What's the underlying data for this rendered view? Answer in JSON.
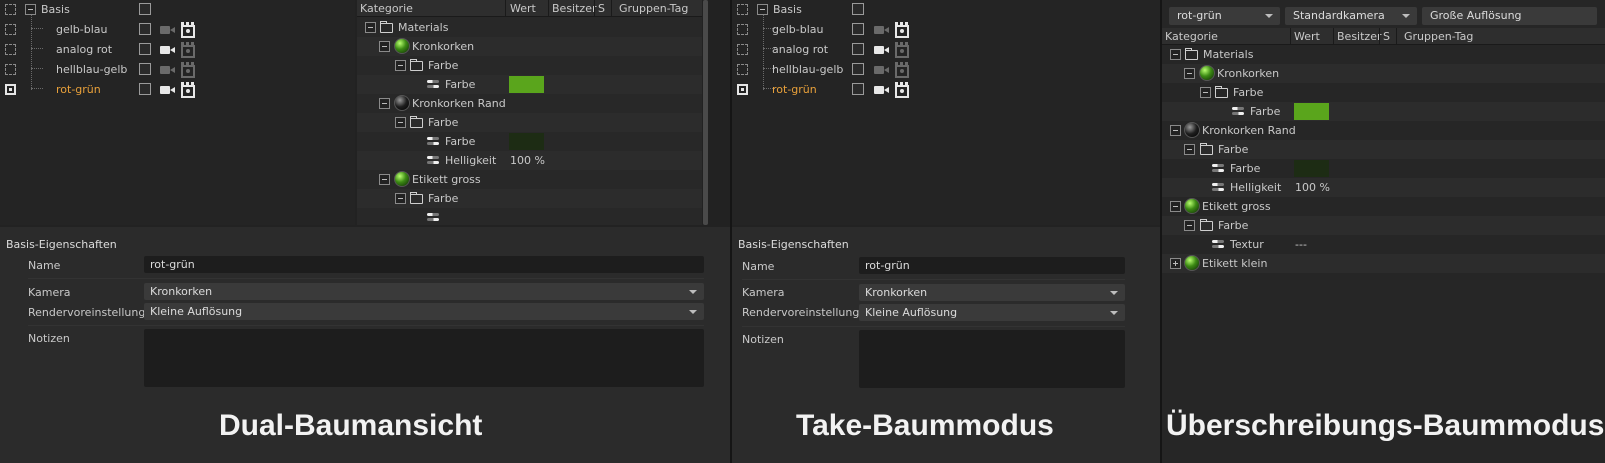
{
  "takes": {
    "root": "Basis",
    "items": [
      {
        "label": "gelb-blau",
        "camera_active": false,
        "render_active": true
      },
      {
        "label": "analog rot",
        "camera_active": true,
        "render_active": false
      },
      {
        "label": "hellblau-gelb",
        "camera_active": false,
        "render_active": false
      },
      {
        "label": "rot-grün",
        "camera_active": true,
        "render_active": true,
        "current": true
      }
    ]
  },
  "override": {
    "headers": {
      "kategorie": "Kategorie",
      "wert": "Wert",
      "besitzer": "Besitzer",
      "s": "S",
      "gruppen_tag": "Gruppen-Tag"
    },
    "rows": {
      "materials": "Materials",
      "kronkorken": "Kronkorken",
      "farbe_group1": "Farbe",
      "farbe_param1": "Farbe",
      "kronkorken_rand": "Kronkorken Rand",
      "farbe_group2": "Farbe",
      "farbe_param2": "Farbe",
      "helligkeit": "Helligkeit",
      "helligkeit_value": "100 %",
      "etikett_gross": "Etikett gross",
      "farbe_group3": "Farbe",
      "textur": "Textur",
      "textur_value": "---",
      "etikett_klein": "Etikett klein"
    },
    "colors": {
      "kronkorken_farbe": "#5aa51c",
      "rand_farbe": "#1d2c14"
    }
  },
  "attributes": {
    "title": "Basis-Eigenschaften",
    "name_label": "Name",
    "name_value": "rot-grün",
    "kamera_label": "Kamera",
    "kamera_value": "Kronkorken",
    "render_label": "Rendervoreinstellungen",
    "render_value": "Kleine Auflösung",
    "notizen_label": "Notizen"
  },
  "toolbar3": {
    "take": "rot-grün",
    "camera": "Standardkamera",
    "render": "Große Auflösung"
  },
  "captions": {
    "p1": "Dual-Baumansicht",
    "p2": "Take-Baummodus",
    "p3": "Überschreibungs-Baummodus"
  }
}
